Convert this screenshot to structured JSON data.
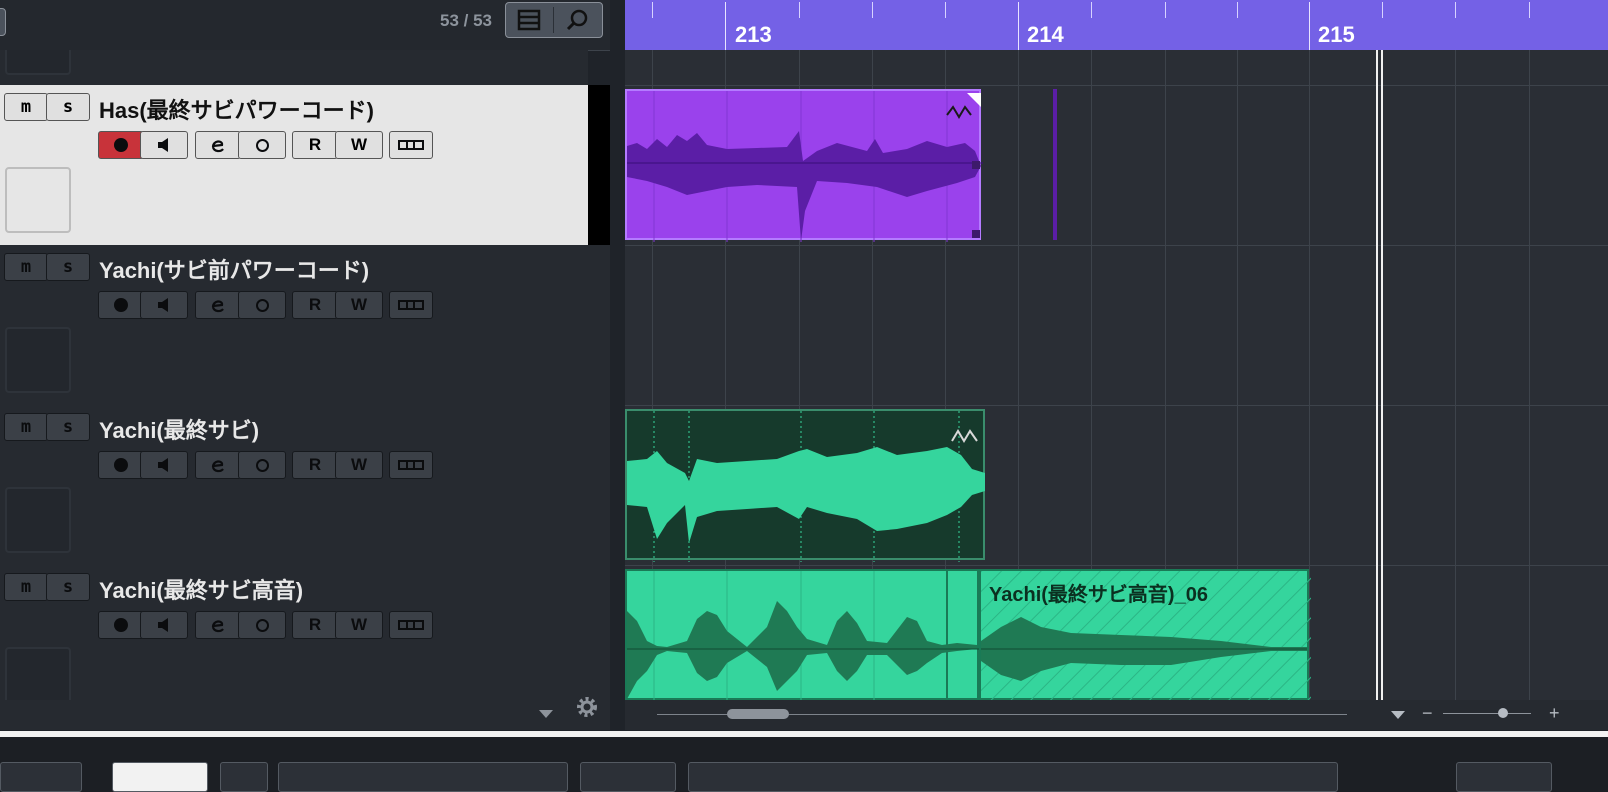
{
  "track_list_header": {
    "count": "53 / 53",
    "list_icon": "list-icon",
    "search_icon": "search-icon"
  },
  "tracks": [
    {
      "name": "Has(最終サビパワーコード)",
      "selected": true,
      "record_enabled": true
    },
    {
      "name": "Yachi(サビ前パワーコード)",
      "selected": false,
      "record_enabled": false
    },
    {
      "name": "Yachi(最終サビ)",
      "selected": false,
      "record_enabled": false
    },
    {
      "name": "Yachi(最終サビ高音)",
      "selected": false,
      "record_enabled": false
    }
  ],
  "track_buttons": {
    "mute": "m",
    "solo": "s",
    "read": "R",
    "write": "W"
  },
  "ruler": {
    "bars": [
      "213",
      "214",
      "215"
    ]
  },
  "events": {
    "track4_event2_label": "Yachi(最終サビ高音)_06"
  },
  "colors": {
    "ruler": "#7461e6",
    "event_purple": "#9a42ec",
    "event_green": "#35d59d",
    "event_dark_green": "#163a2c",
    "record_active": "#c8333a"
  },
  "footer": {
    "zoom_minus": "−",
    "zoom_plus": "+"
  }
}
